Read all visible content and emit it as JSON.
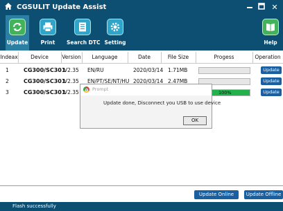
{
  "window": {
    "title": "CGSULIT Update Assist",
    "home_icon": "home-icon",
    "minimize_icon": "minimize-icon",
    "maximize_icon": "maximize-icon",
    "close_icon": "close-icon"
  },
  "toolbar": {
    "items": [
      {
        "label": "Update",
        "icon": "sync-icon"
      },
      {
        "label": "Print",
        "icon": "printer-icon"
      },
      {
        "label": "Search DTC",
        "icon": "document-icon"
      },
      {
        "label": "Setting",
        "icon": "gear-icon"
      },
      {
        "label": "Help",
        "icon": "help-book-icon"
      }
    ]
  },
  "table": {
    "headers": [
      "Indeax",
      "Device",
      "Version",
      "Language",
      "Date",
      "File Size",
      "Progess",
      "Operation"
    ],
    "rows": [
      {
        "index": "1",
        "device": "CG300/SC301",
        "version": "V2.35",
        "language": "EN/RU",
        "date": "2020/03/14",
        "size": "1.71MB",
        "progress": 0,
        "progress_label": "",
        "operation": "Update"
      },
      {
        "index": "2",
        "device": "CG300/SC301",
        "version": "V2.35",
        "language": "EN/PT/SE/NT/HU",
        "date": "2020/03/14",
        "size": "2.47MB",
        "progress": 0,
        "progress_label": "",
        "operation": "Update"
      },
      {
        "index": "3",
        "device": "CG300/SC301",
        "version": "V2.35",
        "language": "",
        "date": "",
        "size": "",
        "progress": 1.0,
        "progress_label": "100%",
        "operation": "Update"
      }
    ]
  },
  "dialog": {
    "title": "Prompt",
    "message": "Update done, Disconnect you USB to use device",
    "ok_label": "OK"
  },
  "bottom": {
    "update_online": "Update Online",
    "update_offline": "Update Offline"
  },
  "status": {
    "text": "Flash successfully"
  },
  "colors": {
    "header_bg": "#0d4f73",
    "button_blue": "#1a5fa0",
    "progress_green": "#22b14c"
  }
}
